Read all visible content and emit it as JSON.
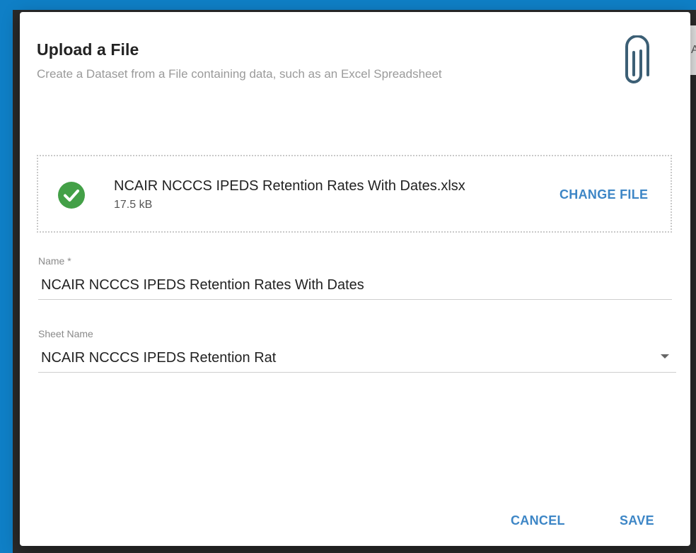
{
  "colors": {
    "accent": "#3d86c6",
    "success": "#43a047",
    "backdrop": "#0f7fc6",
    "icon": "#3c5f75"
  },
  "dialog": {
    "title": "Upload a File",
    "subtitle": "Create a Dataset from a File containing data, such as an Excel Spreadsheet",
    "header_icon": "paperclip-icon"
  },
  "file": {
    "status_icon": "check-circle-icon",
    "name": "NCAIR NCCCS IPEDS Retention Rates With Dates.xlsx",
    "size": "17.5 kB",
    "change_label": "CHANGE FILE"
  },
  "form": {
    "name_label": "Name *",
    "name_value": "NCAIR NCCCS IPEDS Retention Rates With Dates",
    "sheet_label": "Sheet Name",
    "sheet_value": "NCAIR NCCCS IPEDS Retention Rat"
  },
  "actions": {
    "cancel_label": "CANCEL",
    "save_label": "SAVE"
  },
  "background": {
    "partial_letter": "A"
  }
}
